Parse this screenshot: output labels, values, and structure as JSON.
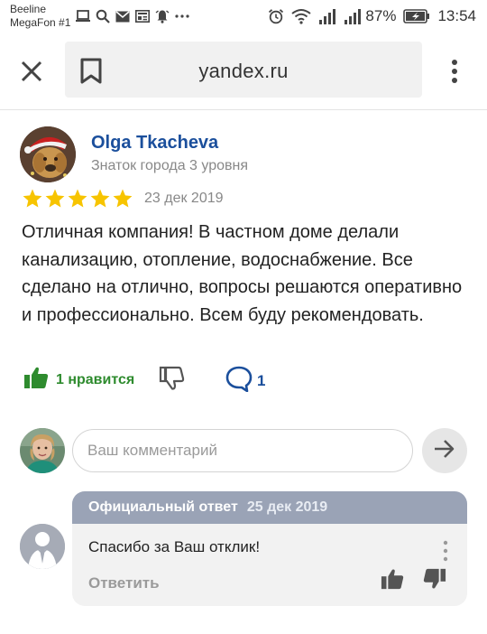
{
  "status_bar": {
    "carrier_line1": "Beeline",
    "carrier_line2": "MegaFon #1",
    "battery": "87%",
    "time": "13:54",
    "icons": [
      "laptop-icon",
      "search-icon",
      "mail-icon",
      "news-icon",
      "alarm-bell-icon",
      "more-icon",
      "alarm-clock-icon",
      "wifi-icon",
      "signal-icon",
      "signal-icon",
      "battery-icon"
    ]
  },
  "browser": {
    "url": "yandex.ru",
    "icons": [
      "close-icon",
      "bookmark-icon",
      "menu-dots-icon"
    ]
  },
  "review": {
    "author": "Olga Tkacheva",
    "level": "Знаток города 3 уровня",
    "rating": 5,
    "rating_max": 5,
    "date": "23 дек 2019",
    "text": "Отличная компания! В частном доме делали канализацию, отопление, водоснабжение. Все сделано на отлично, вопросы решаются оперативно и профессионально. Всем буду рекомендовать.",
    "like_label": "1 нравится",
    "comment_count": "1"
  },
  "comment_box": {
    "placeholder": "Ваш комментарий"
  },
  "official_reply": {
    "title": "Официальный ответ",
    "date": "25 дек 2019",
    "text": "Спасибо за Ваш отклик!",
    "answer_label": "Ответить"
  },
  "colors": {
    "author_link": "#1b4f9c",
    "star": "#f7c400",
    "like_green": "#2e8b2e",
    "reply_header": "#9aa3b6"
  }
}
